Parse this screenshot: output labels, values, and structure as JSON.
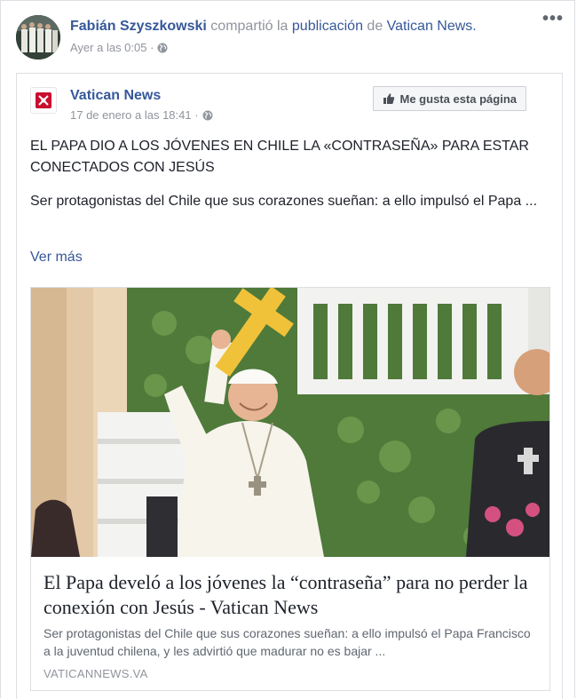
{
  "share_header": {
    "actor": "Fabián Szyszkowski",
    "verb": "compartió la",
    "object": "publicación",
    "preposition": "de",
    "page": "Vatican News.",
    "timestamp": "Ayer a las 0:05 ·",
    "privacy_icon": "globe-icon",
    "menu_icon": "more-options-icon"
  },
  "post": {
    "page_name": "Vatican News",
    "timestamp": "17 de enero a las 18:41 ·",
    "like_page_label": "Me gusta esta página",
    "title": "EL PAPA DIO A LOS JÓVENES EN CHILE LA «CONTRASEÑA» PARA ESTAR CONECTADOS CON JESÚS",
    "excerpt": "Ser protagonistas del Chile que sus corazones sueñan: a ello impulsó el Papa ...",
    "see_more": "Ver más"
  },
  "link_card": {
    "title": "El Papa develó a los jóvenes la “contraseña” para no perder la conexión con Jesús - Vatican News",
    "description": "Ser protagonistas del Chile que sus corazones sueñan: a ello impulsó el Papa Francisco a la juventud chilena, y les advirtió que madurar no es bajar ...",
    "domain": "VATICANNEWS.VA"
  },
  "colors": {
    "link_blue": "#365899",
    "muted_gray": "#90949c",
    "border": "#dddfe2",
    "text": "#1d2129"
  }
}
